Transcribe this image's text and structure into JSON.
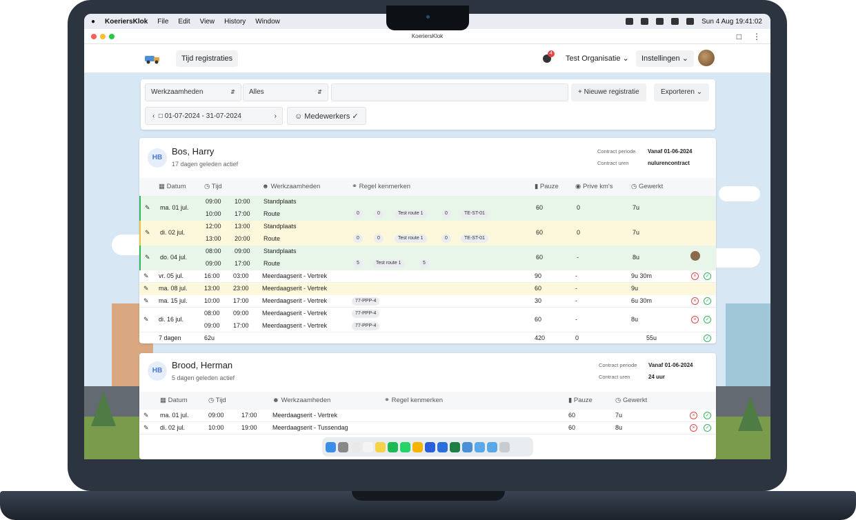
{
  "menubar": {
    "app": "KoeriersKlok",
    "items": [
      "File",
      "Edit",
      "View",
      "History",
      "Window"
    ],
    "clock": "Sun 4 Aug  19:41:02"
  },
  "window": {
    "title": "KoeriersKlok"
  },
  "nav": {
    "tab": "Tijd registraties",
    "badge": "4",
    "org": "Test Organisatie",
    "settings": "Instellingen"
  },
  "toolbar": {
    "filter1": "Werkzaamheden",
    "filter2": "Alles",
    "search_placeholder": "",
    "new": "Nieuwe registratie",
    "export": "Exporteren",
    "date_range": "01-07-2024 - 31-07-2024",
    "staff": "Medewerkers"
  },
  "employees": [
    {
      "initials": "HB",
      "name": "Bos, Harry",
      "active": "17 dagen geleden actief",
      "period_label": "Contract periode",
      "period": "Vanaf 01-06-2024",
      "hours_label": "Contract uren",
      "hours": "nulurencontract",
      "headers": [
        "Datum",
        "Tijd",
        "Werkzaamheden",
        "Regel kenmerken",
        "Pauze",
        "Prive km's",
        "Gewerkt"
      ],
      "total_days": "7 dagen",
      "total_time": "62u",
      "total_pause": "420",
      "total_km": "0",
      "total_worked": "55u"
    },
    {
      "initials": "HB",
      "name": "Brood, Herman",
      "active": "5 dagen geleden actief",
      "period_label": "Contract periode",
      "period": "Vanaf 01-06-2024",
      "hours_label": "Contract uren",
      "hours": "24 uur",
      "headers": [
        "Datum",
        "Tijd",
        "Werkzaamheden",
        "Regel kenmerken",
        "Pauze",
        "Gewerkt"
      ]
    }
  ],
  "rows1": [
    {
      "date": "ma. 01 jul.",
      "start": "09:00",
      "end": "10:00",
      "work": "Standplaats",
      "pause": "60",
      "km": "0",
      "worked": "7u"
    },
    {
      "start": "10:00",
      "end": "17:00",
      "work": "Route",
      "tags": [
        "0",
        "0",
        "Test route 1",
        "0",
        "TE-ST-01"
      ]
    },
    {
      "date": "di. 02 jul.",
      "start": "12:00",
      "end": "13:00",
      "work": "Standplaats",
      "pause": "60",
      "km": "0",
      "worked": "7u"
    },
    {
      "start": "13:00",
      "end": "20:00",
      "work": "Route",
      "tags": [
        "0",
        "0",
        "Test route 1",
        "0",
        "TE-ST-01"
      ]
    },
    {
      "date": "do. 04 jul.",
      "start": "08:00",
      "end": "09:00",
      "work": "Standplaats",
      "pause": "60",
      "km": "-",
      "worked": "8u"
    },
    {
      "start": "09:00",
      "end": "17:00",
      "work": "Route",
      "tags": [
        "5",
        "Test route 1",
        "5"
      ]
    },
    {
      "date": "vr. 05 jul.",
      "start": "16:00",
      "end": "03:00",
      "work": "Meerdaagserit - Vertrek",
      "pause": "90",
      "km": "-",
      "worked": "9u 30m"
    },
    {
      "date": "ma. 08 jul.",
      "start": "13:00",
      "end": "23:00",
      "work": "Meerdaagserit - Vertrek",
      "pause": "60",
      "km": "-",
      "worked": "9u"
    },
    {
      "date": "ma. 15 jul.",
      "start": "10:00",
      "end": "17:00",
      "work": "Meerdaagserit - Vertrek",
      "pause": "30",
      "km": "-",
      "worked": "6u 30m",
      "plate": "77-PPP-4"
    },
    {
      "date": "di. 16 jul.",
      "start": "08:00",
      "end": "09:00",
      "work": "Meerdaagserit - Vertrek",
      "pause": "60",
      "km": "-",
      "worked": "8u",
      "plate": "77-PPP-4"
    },
    {
      "start": "09:00",
      "end": "17:00",
      "work": "Meerdaagserit - Vertrek",
      "plate": "77-PPP-4"
    }
  ],
  "rows2": [
    {
      "date": "ma. 01 jul.",
      "start": "09:00",
      "end": "17:00",
      "work": "Meerdaagserit - Vertrek",
      "pause": "60",
      "worked": "7u"
    },
    {
      "date": "di. 02 jul.",
      "start": "10:00",
      "end": "19:00",
      "work": "Meerdaagserit - Tussendag",
      "pause": "60",
      "worked": "8u"
    }
  ],
  "colors": {
    "green_row": "#e8f6ea",
    "yellow_row": "#fdf8dc",
    "accent": "#4a78d1",
    "red": "#e04848",
    "ok": "#2fb45b"
  }
}
